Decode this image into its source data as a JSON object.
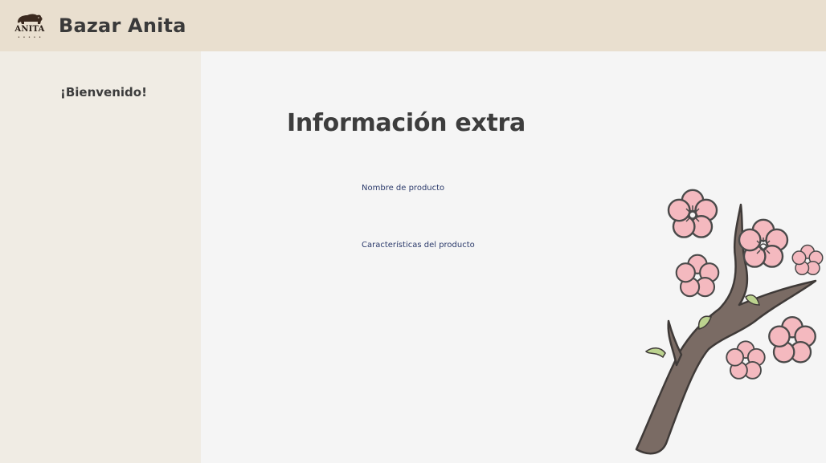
{
  "header": {
    "logo_text": "ANITA",
    "logo_subtext": "• • • • •",
    "title": "Bazar Anita"
  },
  "sidebar": {
    "welcome": "¡Bienvenido!"
  },
  "main": {
    "title": "Información extra",
    "fields": {
      "product_name_label": "Nombre de producto",
      "product_features_label": "Características del producto"
    }
  },
  "colors": {
    "header_bg": "#e9dfcf",
    "sidebar_bg": "#f0ece4",
    "main_bg": "#f5f5f5",
    "label_color": "#2b3a6b",
    "blossom_pink": "#f4b9bf",
    "branch_brown": "#7a6b64"
  },
  "icons": {
    "logo": "bear-logo-icon",
    "decoration": "cherry-blossom-branch-icon"
  }
}
